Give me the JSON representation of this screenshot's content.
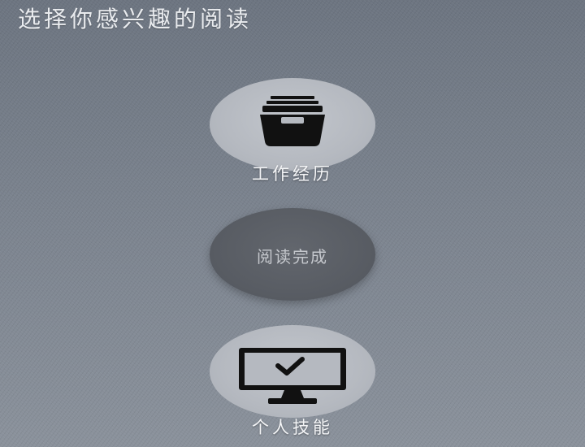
{
  "page": {
    "title": "选择你感兴趣的阅读"
  },
  "menu": {
    "work_experience": {
      "label": "工作经历",
      "icon": "archive-box-icon"
    },
    "reading_done": {
      "label": "阅读完成"
    },
    "skills": {
      "label": "个人技能",
      "icon": "monitor-check-icon"
    }
  },
  "colors": {
    "background": "#7b838e",
    "circle_light": "#b5b9c0",
    "circle_dark": "#585c63",
    "icon": "#111111",
    "text": "#f3f4f6"
  }
}
